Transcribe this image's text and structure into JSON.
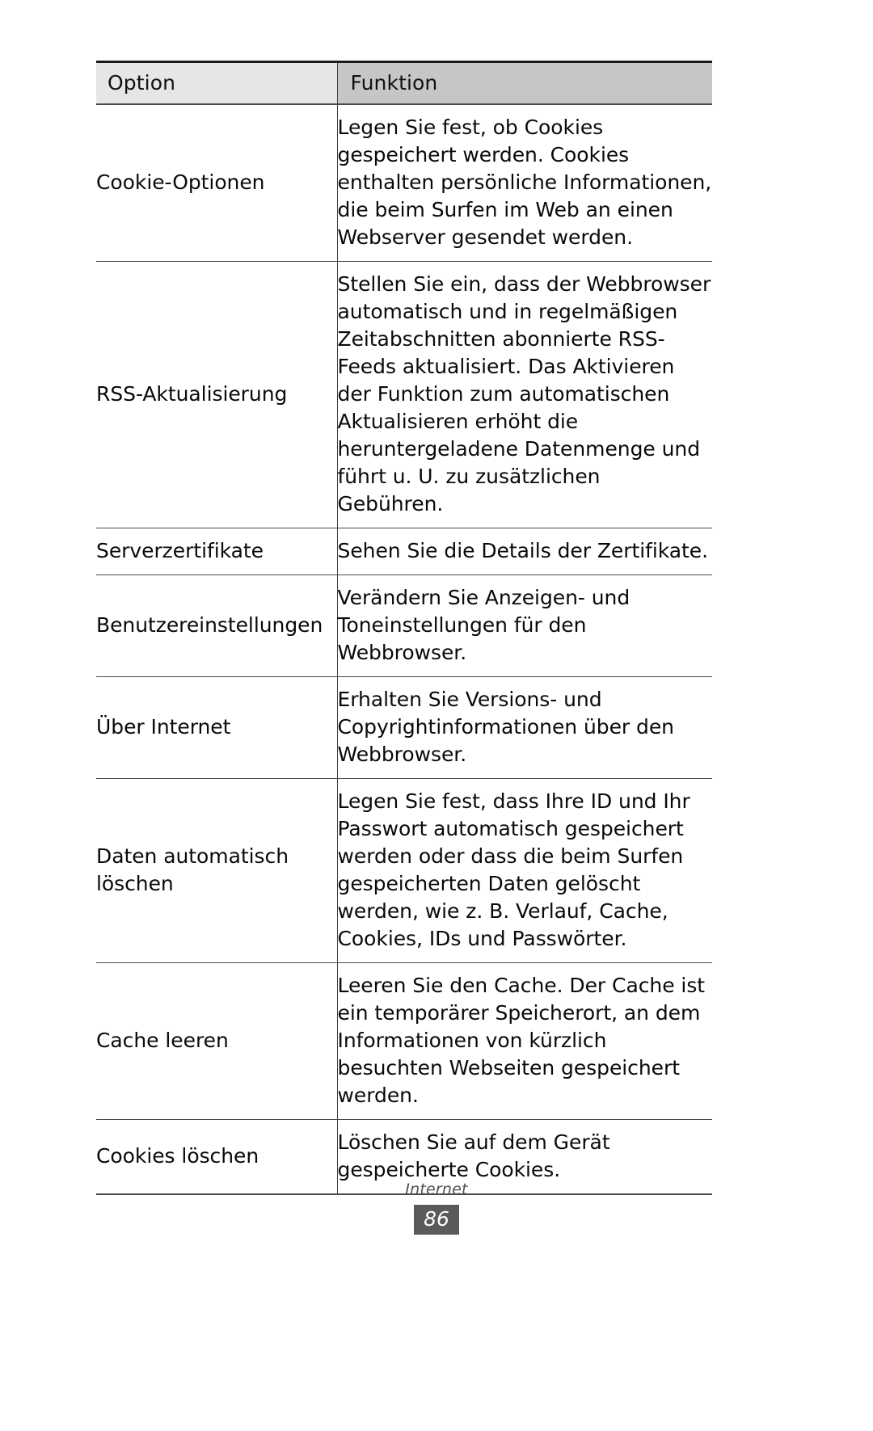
{
  "document": {
    "type": "user-manual-table-page"
  },
  "table": {
    "headers": {
      "option": "Option",
      "funktion": "Funktion"
    },
    "header_colors": {
      "option_bg": "#e6e6e6",
      "funktion_bg": "#c6c6c6",
      "rule": "#4a4a4a"
    },
    "rows": [
      {
        "option": "Cookie-Optionen",
        "funktion": "Legen Sie fest, ob Cookies gespeichert werden. Cookies enthalten persönliche Informationen, die beim Surfen im Web an einen Webserver gesendet werden."
      },
      {
        "option": "RSS-Aktualisierung",
        "funktion": "Stellen Sie ein, dass der Webbrowser automatisch und in regelmäßigen Zeitabschnitten abonnierte RSS-Feeds aktualisiert. Das Aktivieren der Funktion zum automatischen Aktualisieren erhöht die heruntergeladene Datenmenge und führt u. U. zu zusätzlichen Gebühren."
      },
      {
        "option": "Serverzertifikate",
        "funktion": "Sehen Sie die Details der Zertifikate."
      },
      {
        "option": "Benutzereinstellungen",
        "funktion": "Verändern Sie Anzeigen- und Toneinstellungen für den Webbrowser."
      },
      {
        "option": "Über Internet",
        "funktion": "Erhalten Sie Versions- und Copyrightinformationen über den Webbrowser."
      },
      {
        "option": "Daten automatisch löschen",
        "funktion": "Legen Sie fest, dass Ihre ID und Ihr Passwort automatisch gespeichert werden oder dass die beim Surfen gespeicherten Daten gelöscht werden, wie z. B. Verlauf, Cache, Cookies, IDs und Passwörter."
      },
      {
        "option": "Cache leeren",
        "funktion": "Leeren Sie den Cache. Der Cache ist ein temporärer Speicherort, an dem Informationen von kürzlich besuchten Webseiten gespeichert werden."
      },
      {
        "option": "Cookies löschen",
        "funktion": "Löschen Sie auf dem Gerät gespeicherte Cookies."
      }
    ]
  },
  "footer": {
    "section_title": "Internet",
    "page_number": "86",
    "page_box_color": "#5a5a5a"
  }
}
